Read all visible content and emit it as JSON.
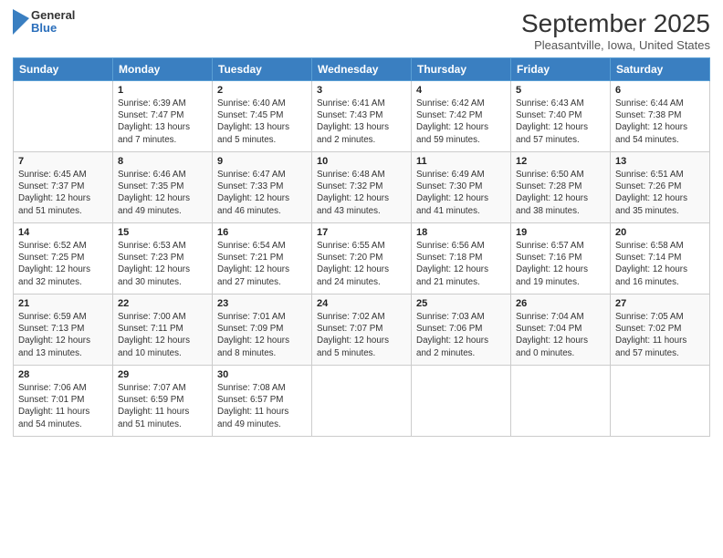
{
  "logo": {
    "general": "General",
    "blue": "Blue"
  },
  "title": "September 2025",
  "location": "Pleasantville, Iowa, United States",
  "days_header": [
    "Sunday",
    "Monday",
    "Tuesday",
    "Wednesday",
    "Thursday",
    "Friday",
    "Saturday"
  ],
  "weeks": [
    [
      {
        "num": "",
        "info": ""
      },
      {
        "num": "1",
        "info": "Sunrise: 6:39 AM\nSunset: 7:47 PM\nDaylight: 13 hours\nand 7 minutes."
      },
      {
        "num": "2",
        "info": "Sunrise: 6:40 AM\nSunset: 7:45 PM\nDaylight: 13 hours\nand 5 minutes."
      },
      {
        "num": "3",
        "info": "Sunrise: 6:41 AM\nSunset: 7:43 PM\nDaylight: 13 hours\nand 2 minutes."
      },
      {
        "num": "4",
        "info": "Sunrise: 6:42 AM\nSunset: 7:42 PM\nDaylight: 12 hours\nand 59 minutes."
      },
      {
        "num": "5",
        "info": "Sunrise: 6:43 AM\nSunset: 7:40 PM\nDaylight: 12 hours\nand 57 minutes."
      },
      {
        "num": "6",
        "info": "Sunrise: 6:44 AM\nSunset: 7:38 PM\nDaylight: 12 hours\nand 54 minutes."
      }
    ],
    [
      {
        "num": "7",
        "info": "Sunrise: 6:45 AM\nSunset: 7:37 PM\nDaylight: 12 hours\nand 51 minutes."
      },
      {
        "num": "8",
        "info": "Sunrise: 6:46 AM\nSunset: 7:35 PM\nDaylight: 12 hours\nand 49 minutes."
      },
      {
        "num": "9",
        "info": "Sunrise: 6:47 AM\nSunset: 7:33 PM\nDaylight: 12 hours\nand 46 minutes."
      },
      {
        "num": "10",
        "info": "Sunrise: 6:48 AM\nSunset: 7:32 PM\nDaylight: 12 hours\nand 43 minutes."
      },
      {
        "num": "11",
        "info": "Sunrise: 6:49 AM\nSunset: 7:30 PM\nDaylight: 12 hours\nand 41 minutes."
      },
      {
        "num": "12",
        "info": "Sunrise: 6:50 AM\nSunset: 7:28 PM\nDaylight: 12 hours\nand 38 minutes."
      },
      {
        "num": "13",
        "info": "Sunrise: 6:51 AM\nSunset: 7:26 PM\nDaylight: 12 hours\nand 35 minutes."
      }
    ],
    [
      {
        "num": "14",
        "info": "Sunrise: 6:52 AM\nSunset: 7:25 PM\nDaylight: 12 hours\nand 32 minutes."
      },
      {
        "num": "15",
        "info": "Sunrise: 6:53 AM\nSunset: 7:23 PM\nDaylight: 12 hours\nand 30 minutes."
      },
      {
        "num": "16",
        "info": "Sunrise: 6:54 AM\nSunset: 7:21 PM\nDaylight: 12 hours\nand 27 minutes."
      },
      {
        "num": "17",
        "info": "Sunrise: 6:55 AM\nSunset: 7:20 PM\nDaylight: 12 hours\nand 24 minutes."
      },
      {
        "num": "18",
        "info": "Sunrise: 6:56 AM\nSunset: 7:18 PM\nDaylight: 12 hours\nand 21 minutes."
      },
      {
        "num": "19",
        "info": "Sunrise: 6:57 AM\nSunset: 7:16 PM\nDaylight: 12 hours\nand 19 minutes."
      },
      {
        "num": "20",
        "info": "Sunrise: 6:58 AM\nSunset: 7:14 PM\nDaylight: 12 hours\nand 16 minutes."
      }
    ],
    [
      {
        "num": "21",
        "info": "Sunrise: 6:59 AM\nSunset: 7:13 PM\nDaylight: 12 hours\nand 13 minutes."
      },
      {
        "num": "22",
        "info": "Sunrise: 7:00 AM\nSunset: 7:11 PM\nDaylight: 12 hours\nand 10 minutes."
      },
      {
        "num": "23",
        "info": "Sunrise: 7:01 AM\nSunset: 7:09 PM\nDaylight: 12 hours\nand 8 minutes."
      },
      {
        "num": "24",
        "info": "Sunrise: 7:02 AM\nSunset: 7:07 PM\nDaylight: 12 hours\nand 5 minutes."
      },
      {
        "num": "25",
        "info": "Sunrise: 7:03 AM\nSunset: 7:06 PM\nDaylight: 12 hours\nand 2 minutes."
      },
      {
        "num": "26",
        "info": "Sunrise: 7:04 AM\nSunset: 7:04 PM\nDaylight: 12 hours\nand 0 minutes."
      },
      {
        "num": "27",
        "info": "Sunrise: 7:05 AM\nSunset: 7:02 PM\nDaylight: 11 hours\nand 57 minutes."
      }
    ],
    [
      {
        "num": "28",
        "info": "Sunrise: 7:06 AM\nSunset: 7:01 PM\nDaylight: 11 hours\nand 54 minutes."
      },
      {
        "num": "29",
        "info": "Sunrise: 7:07 AM\nSunset: 6:59 PM\nDaylight: 11 hours\nand 51 minutes."
      },
      {
        "num": "30",
        "info": "Sunrise: 7:08 AM\nSunset: 6:57 PM\nDaylight: 11 hours\nand 49 minutes."
      },
      {
        "num": "",
        "info": ""
      },
      {
        "num": "",
        "info": ""
      },
      {
        "num": "",
        "info": ""
      },
      {
        "num": "",
        "info": ""
      }
    ]
  ]
}
